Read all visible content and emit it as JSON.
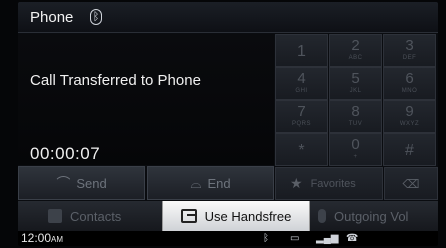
{
  "header": {
    "title": "Phone"
  },
  "call": {
    "status": "Call Transferred to Phone",
    "timer": "00:00:07"
  },
  "actions": {
    "send": "Send",
    "end": "End"
  },
  "keypad": {
    "keys": [
      {
        "digit": "1",
        "letters": ""
      },
      {
        "digit": "2",
        "letters": "ABC"
      },
      {
        "digit": "3",
        "letters": "DEF"
      },
      {
        "digit": "4",
        "letters": "GHI"
      },
      {
        "digit": "5",
        "letters": "JKL"
      },
      {
        "digit": "6",
        "letters": "MNO"
      },
      {
        "digit": "7",
        "letters": "PQRS"
      },
      {
        "digit": "8",
        "letters": "TUV"
      },
      {
        "digit": "9",
        "letters": "WXYZ"
      },
      {
        "digit": "*",
        "letters": ""
      },
      {
        "digit": "0",
        "letters": "+"
      },
      {
        "digit": "#",
        "letters": ""
      }
    ],
    "favorites": "Favorites"
  },
  "tabs": {
    "contacts": "Contacts",
    "handsfree": "Use Handsfree",
    "outgoing": "Outgoing Vol"
  },
  "status": {
    "time": "12:00",
    "ampm": "AM"
  }
}
